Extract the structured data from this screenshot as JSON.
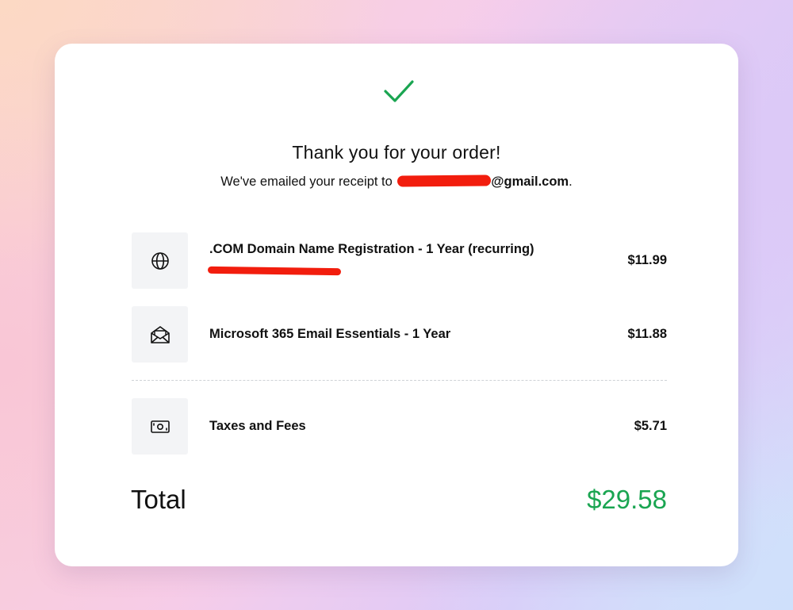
{
  "colors": {
    "accent_green": "#1aa551",
    "redaction_red": "#f21d0d",
    "icon_box_bg": "#f3f4f6",
    "text": "#111111"
  },
  "header": {
    "icon": "check-icon",
    "title": "Thank you for your order!",
    "receipt_prefix": "We've emailed your receipt to",
    "email_domain": "@gmail.com",
    "receipt_suffix": "."
  },
  "items": [
    {
      "icon": "globe-icon",
      "name": ".COM Domain Name Registration - 1 Year (recurring)",
      "price": "$11.99"
    },
    {
      "icon": "envelope-open-icon",
      "name": "Microsoft 365 Email Essentials - 1 Year",
      "price": "$11.88"
    }
  ],
  "fees": {
    "icon": "cash-icon",
    "name": "Taxes and Fees",
    "price": "$5.71"
  },
  "total": {
    "label": "Total",
    "value": "$29.58"
  }
}
